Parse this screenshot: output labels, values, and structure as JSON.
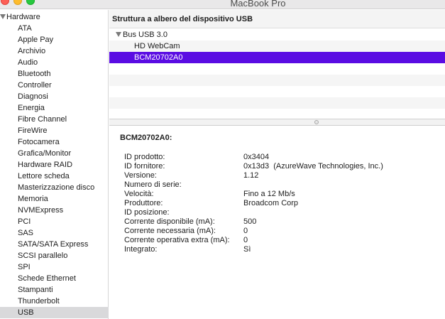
{
  "window": {
    "title": "MacBook Pro"
  },
  "sidebar": {
    "group_label": "Hardware",
    "items": [
      {
        "label": "ATA"
      },
      {
        "label": "Apple Pay"
      },
      {
        "label": "Archivio"
      },
      {
        "label": "Audio"
      },
      {
        "label": "Bluetooth"
      },
      {
        "label": "Controller"
      },
      {
        "label": "Diagnosi"
      },
      {
        "label": "Energia"
      },
      {
        "label": "Fibre Channel"
      },
      {
        "label": "FireWire"
      },
      {
        "label": "Fotocamera"
      },
      {
        "label": "Grafica/Monitor"
      },
      {
        "label": "Hardware RAID"
      },
      {
        "label": "Lettore scheda"
      },
      {
        "label": "Masterizzazione disco"
      },
      {
        "label": "Memoria"
      },
      {
        "label": "NVMExpress"
      },
      {
        "label": "PCI"
      },
      {
        "label": "SAS"
      },
      {
        "label": "SATA/SATA Express"
      },
      {
        "label": "SCSI parallelo"
      },
      {
        "label": "SPI"
      },
      {
        "label": "Schede Ethernet"
      },
      {
        "label": "Stampanti"
      },
      {
        "label": "Thunderbolt"
      },
      {
        "label": "USB",
        "selected": true
      }
    ]
  },
  "tree": {
    "header": "Struttura a albero del dispositivo USB",
    "bus_label": "Bus USB 3.0",
    "devices": [
      {
        "label": "HD WebCam"
      },
      {
        "label": "BCM20702A0",
        "selected": true
      }
    ]
  },
  "detail": {
    "title": "BCM20702A0:",
    "properties": [
      {
        "label": "ID prodotto:",
        "value": "0x3404"
      },
      {
        "label": "ID fornitore:",
        "value": "0x13d3  (AzureWave Technologies, Inc.)"
      },
      {
        "label": "Versione:",
        "value": "1.12"
      },
      {
        "label": "Numero di serie:",
        "value": ""
      },
      {
        "label": "Velocità:",
        "value": "Fino a 12 Mb/s"
      },
      {
        "label": "Produttore:",
        "value": "Broadcom Corp"
      },
      {
        "label": "ID posizione:",
        "value": ""
      },
      {
        "label": "Corrente disponibile (mA):",
        "value": "500"
      },
      {
        "label": "Corrente necessaria (mA):",
        "value": "0"
      },
      {
        "label": "Corrente operativa extra (mA):",
        "value": "0"
      },
      {
        "label": "Integrato:",
        "value": "Sì"
      }
    ]
  },
  "colors": {
    "selection_accent": "#5a0ce3",
    "sidebar_selection": "#d9d9db",
    "close_button": "#fd5f57",
    "minimize_button": "#febc2e",
    "zoom_button": "#28c840"
  }
}
